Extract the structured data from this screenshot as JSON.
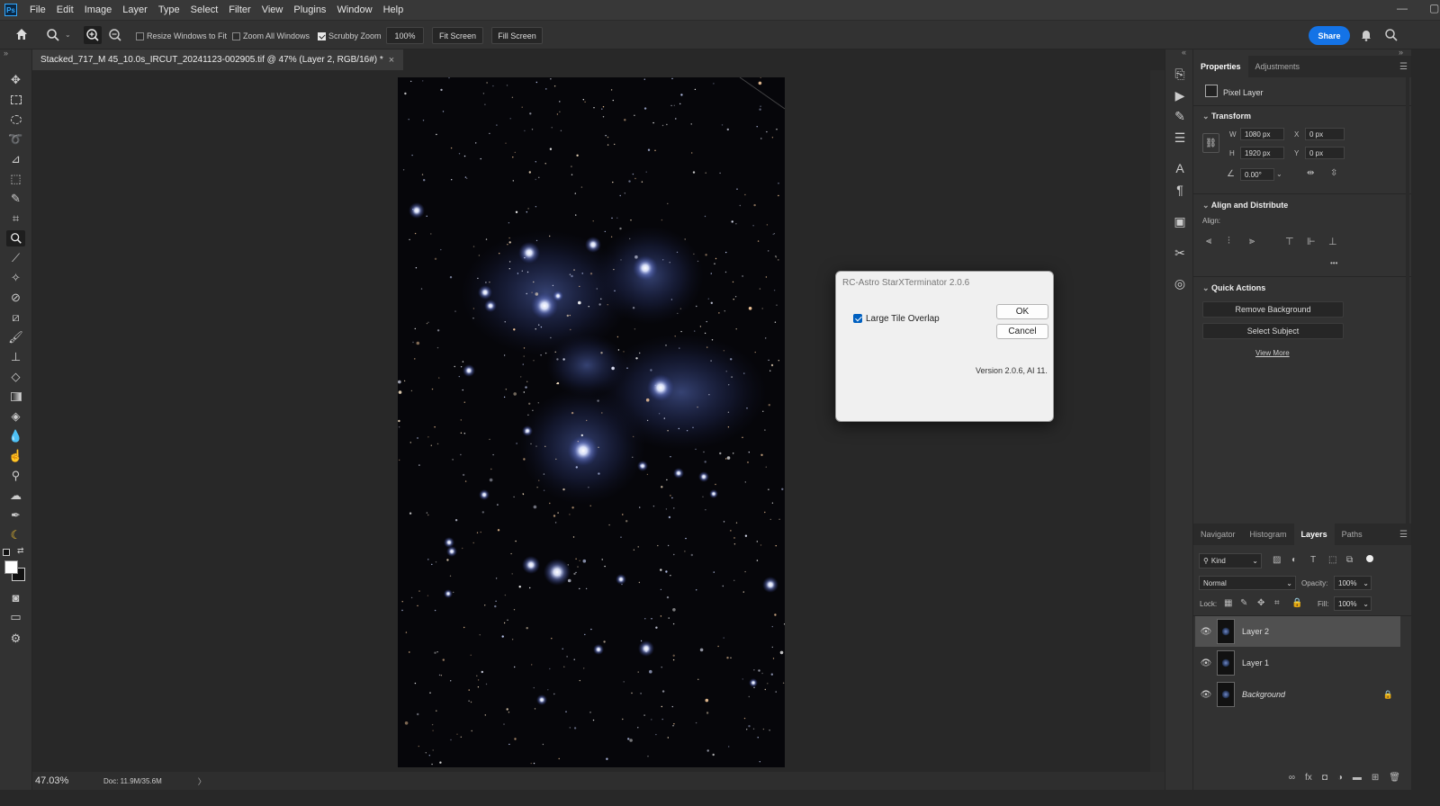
{
  "menubar": {
    "app_icon": "Ps",
    "items": [
      "File",
      "Edit",
      "Image",
      "Layer",
      "Type",
      "Select",
      "Filter",
      "View",
      "Plugins",
      "Window",
      "Help"
    ]
  },
  "options_bar": {
    "resize_windows_label": "Resize Windows to Fit",
    "resize_windows_checked": false,
    "zoom_all_label": "Zoom All Windows",
    "zoom_all_checked": false,
    "scrubby_zoom_label": "Scrubby Zoom",
    "scrubby_zoom_checked": true,
    "zoom_value": "100%",
    "fit_screen_label": "Fit Screen",
    "fill_screen_label": "Fill Screen",
    "share_label": "Share"
  },
  "document": {
    "tab_title": "Stacked_717_M 45_10.0s_IRCUT_20241123-002905.tif @ 47% (Layer 2, RGB/16#) *",
    "close_glyph": "×"
  },
  "status": {
    "zoom": "47.03%",
    "doc_size": "Doc: 11.9M/35.6M",
    "arrow": "〉"
  },
  "dialog": {
    "title": "RC-Astro StarXTerminator 2.0.6",
    "checkbox_label": "Large Tile Overlap",
    "checkbox_checked": true,
    "ok_label": "OK",
    "cancel_label": "Cancel",
    "version_text": "Version 2.0.6, AI 11."
  },
  "properties": {
    "tabs": [
      "Properties",
      "Adjustments"
    ],
    "active_tab": "Properties",
    "layer_kind": "Pixel Layer",
    "transform_title": "Transform",
    "w_label": "W",
    "w_value": "1080 px",
    "h_label": "H",
    "h_value": "1920 px",
    "x_label": "X",
    "x_value": "0 px",
    "y_label": "Y",
    "y_value": "0 px",
    "angle_value": "0.00°",
    "align_title": "Align and Distribute",
    "align_label": "Align:",
    "more_glyph": "•••",
    "quick_actions_title": "Quick Actions",
    "remove_bg_label": "Remove Background",
    "select_subject_label": "Select Subject",
    "view_more_label": "View More"
  },
  "layers_panel": {
    "tabs": [
      "Navigator",
      "Histogram",
      "Layers",
      "Paths"
    ],
    "active_tab": "Layers",
    "filter_kind": "Kind",
    "blend_mode": "Normal",
    "opacity_label": "Opacity:",
    "opacity_value": "100%",
    "lock_label": "Lock:",
    "fill_label": "Fill:",
    "fill_value": "100%",
    "layers": [
      {
        "name": "Layer 2",
        "selected": true,
        "locked": false,
        "italic": false
      },
      {
        "name": "Layer 1",
        "selected": false,
        "locked": false,
        "italic": false
      },
      {
        "name": "Background",
        "selected": false,
        "locked": true,
        "italic": true
      }
    ]
  },
  "colors": {
    "accent": "#1473e6",
    "panel_bg": "#323232",
    "canvas_bg": "#282828"
  }
}
